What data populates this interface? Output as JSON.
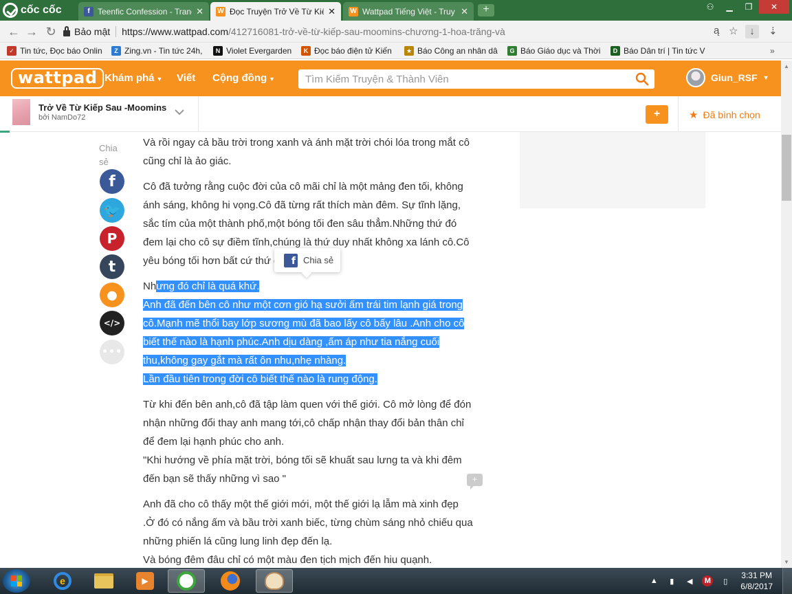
{
  "browser": {
    "brand": "cốc cốc",
    "tabs": [
      {
        "title": "Teenfic Confession - Trang",
        "icon": "facebook-icon",
        "icon_color": "#3b5998",
        "active": false
      },
      {
        "title": "Đọc Truyện Trở Về Từ Kiếp",
        "icon": "wattpad-icon",
        "icon_color": "#f7921e",
        "active": true
      },
      {
        "title": "Wattpad Tiếng Việt - Truy",
        "icon": "wattpad-icon",
        "icon_color": "#f7921e",
        "active": false
      }
    ],
    "secure_label": "Bảo mật",
    "url_host": "https://www.wattpad.com",
    "url_path": "/412716081-trở-về-từ-kiếp-sau-moomins-chương-1-hoa-trăng-và",
    "bookmarks": [
      {
        "label": "Tin tức, Đọc báo Onlin",
        "icon_color": "#c0392b"
      },
      {
        "label": "Zing.vn - Tin tức 24h,",
        "icon_color": "#2c7bd1"
      },
      {
        "label": "Violet Evergarden",
        "icon_color": "#111111"
      },
      {
        "label": "Đọc báo điện tử Kiến",
        "icon_color": "#d35400"
      },
      {
        "label": "Báo Công an nhân dâ",
        "icon_color": "#b8860b"
      },
      {
        "label": "Báo Giáo dục và Thời",
        "icon_color": "#2e7d32"
      },
      {
        "label": "Báo Dân trí | Tin tức V",
        "icon_color": "#1b5e20"
      }
    ]
  },
  "wattpad": {
    "logo": "wattpad",
    "nav": {
      "explore": "Khám phá",
      "write": "Viết",
      "community": "Cộng đồng"
    },
    "search_placeholder": "Tìm Kiếm Truyện & Thành Viên",
    "username": "Giun_RSF",
    "brand_color": "#f7921e"
  },
  "story": {
    "title": "Trở Về Từ Kiếp Sau -Moomins",
    "author": "bởi NamDo72",
    "add_label": "+",
    "vote_label": "Đã bình chọn"
  },
  "share": {
    "label": "Chia sẻ",
    "buttons": [
      {
        "name": "facebook",
        "glyph": "f",
        "color": "#3b5998"
      },
      {
        "name": "twitter",
        "glyph": "t",
        "color": "#2ea6de"
      },
      {
        "name": "pinterest",
        "glyph": "P",
        "color": "#c8232c"
      },
      {
        "name": "tumblr",
        "glyph": "t",
        "color": "#35465c"
      },
      {
        "name": "user",
        "glyph": "●",
        "color": "#f7921e"
      },
      {
        "name": "embed",
        "glyph": "</>",
        "color": "#222222"
      },
      {
        "name": "more",
        "glyph": "•••",
        "color": "#e8e8e8"
      }
    ]
  },
  "article": {
    "p1": "Và rồi ngay cả bầu trời trong xanh và ánh mặt trời chói lóa trong mắt cô cũng chỉ là ảo giác.",
    "p2": "Cô đã tưởng rằng cuộc đời của cô mãi chỉ là một mảng đen tối, không ánh sáng, không hi vọng.Cô đã từng rất thích màn đêm. Sự tĩnh lặng, sắc tím của một thành phố,một bóng tối đen sâu thẳm.Những thứ đó đem lại cho cô sự điềm tĩnh,chúng là thứ duy nhất không xa lánh cô.Cô yêu bóng tối hơn bất cứ thứ gì.",
    "p3_lead": "Nh",
    "p3_sel1": "ưng đó chỉ là quá khứ.",
    "p3_sel2": "Anh đã đến bên cô như một cơn gió hạ sưởi ấm trái tim lạnh giá trong cô.Mạnh mẽ thổi bay lớp sương mù đã bao lấy cô bấy lâu .Anh cho cô biết thế nào là hạnh phúc.Anh dịu dàng ,ấm áp như tia nắng cuối thu,không gay gắt mà rất ôn nhu,nhẹ nhàng.",
    "p3_sel3": "Lần đầu tiên trong đời cô biết thế nào là rung động.",
    "p4a": "Từ khi đến bên anh,cô đã tập làm quen với thế giới. Cô mở lòng để đón nhận những đổi thay anh mang tới,cô chấp nhận thay đổi bản thân chỉ để đem lại hạnh phúc cho anh.",
    "p4b": "\"Khi hướng về phía mặt trời, bóng tối sẽ khuất sau lưng ta và khi đêm đến bạn sẽ thấy những vì sao \"",
    "p5a": "Anh đã cho cô thấy một thế giới mới, một thế giới lạ lẫm mà xinh đẹp .Ở đó có nắng ấm và bầu trời xanh biếc, từng chùm sáng nhỏ chiếu qua những phiến lá cũng lung linh đẹp đến lạ.",
    "p5b": "Và bóng đêm đâu chỉ có một màu đen tịch mịch đến hiu quạnh.",
    "tooltip": "Chia sẻ",
    "comment_glyph": "+"
  },
  "taskbar": {
    "time": "3:31 PM",
    "date": "6/8/2017",
    "tray_arrow": "▲"
  }
}
